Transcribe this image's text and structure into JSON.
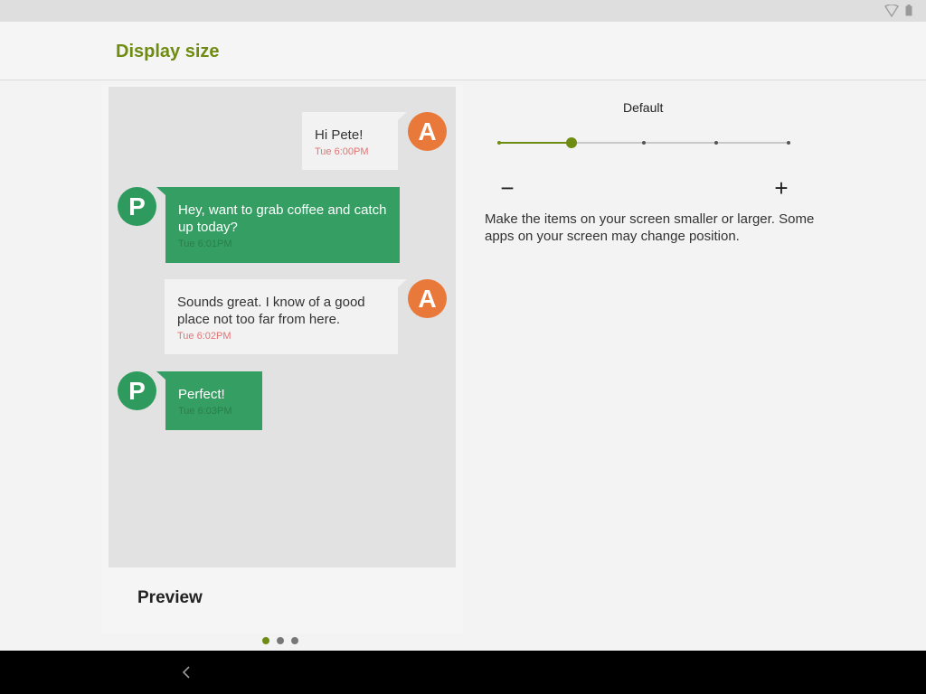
{
  "header": {
    "title": "Display size"
  },
  "preview": {
    "label": "Preview",
    "messages": [
      {
        "avatar": "A",
        "text": "Hi Pete!",
        "time": "Tue 6:00PM"
      },
      {
        "avatar": "P",
        "text": "Hey, want to grab coffee and catch up today?",
        "time": "Tue 6:01PM"
      },
      {
        "avatar": "A",
        "text": "Sounds great. I know of a good place not too far from here.",
        "time": "Tue 6:02PM"
      },
      {
        "avatar": "P",
        "text": "Perfect!",
        "time": "Tue 6:03PM"
      }
    ]
  },
  "size": {
    "current_label": "Default",
    "steps": 5,
    "current_index": 1,
    "decrease_symbol": "−",
    "increase_symbol": "+",
    "description": "Make the items on your screen smaller or larger. Some apps on your screen may change position."
  },
  "pager": {
    "count": 3,
    "active": 0
  },
  "colors": {
    "accent": "#6e8b12",
    "outgoing_bubble": "#349e63",
    "avatar_a": "#e8793a",
    "avatar_p": "#2e9a5e"
  },
  "icons": {
    "status": [
      "wifi-icon",
      "battery-icon"
    ],
    "nav": [
      "back-icon"
    ]
  }
}
